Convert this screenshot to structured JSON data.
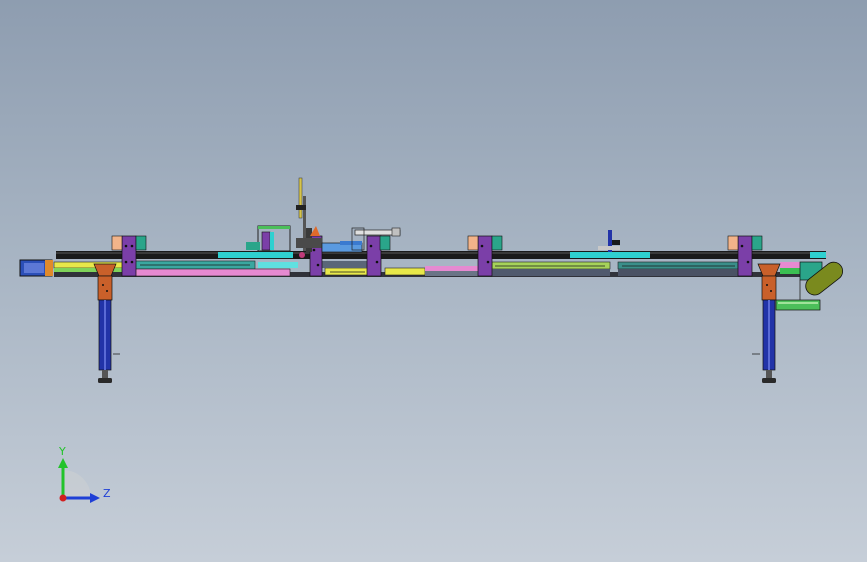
{
  "viewport": {
    "background_top": "#8e9db0",
    "background_bottom": "#c6ced8"
  },
  "model": {
    "description_colors": {
      "frame": "#1a1a1a",
      "purple_bracket": "#7b3fa8",
      "orange_leg": "#c9602a",
      "blue_leg": "#2233a8",
      "cyan": "#2fd0d0",
      "yellow": "#e8e84a",
      "pink": "#e68ad1",
      "green": "#4bbf5a",
      "olive": "#7a8a1e",
      "teal": "#2aa58a",
      "peach": "#f2b48a"
    }
  },
  "triad": {
    "y_label": "Y",
    "z_label": "Z",
    "y_color": "#22c32a",
    "z_color": "#1f3fd6",
    "origin_color": "#d21f1f"
  }
}
